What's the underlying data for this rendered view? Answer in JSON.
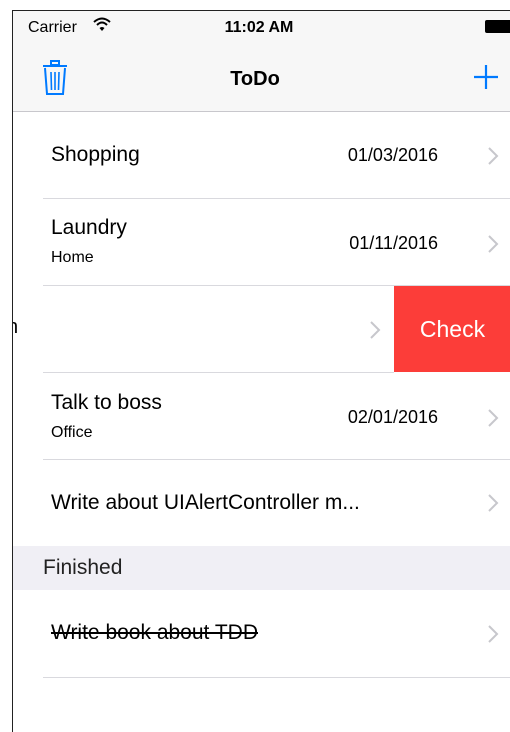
{
  "status_bar": {
    "carrier": "Carrier",
    "time": "11:02 AM"
  },
  "nav": {
    "title": "ToDo",
    "trash_icon": "trash-icon",
    "add_icon": "plus-icon",
    "accent_color": "#007aff"
  },
  "todo_items": [
    {
      "title": "Shopping",
      "subtitle": "",
      "date": "01/03/2016"
    },
    {
      "title": "Laundry",
      "subtitle": "Home",
      "date": "01/11/2016"
    },
    {
      "title": "h",
      "subtitle": "",
      "date": "",
      "swipe_action": "Check"
    },
    {
      "title": "Talk to boss",
      "subtitle": "Office",
      "date": "02/01/2016"
    },
    {
      "title": "Write about UIAlertController m...",
      "subtitle": "",
      "date": ""
    }
  ],
  "swipe_action_color": "#fc3d39",
  "finished_section": {
    "header": "Finished",
    "items": [
      {
        "title": "Write book about TDD"
      }
    ]
  }
}
